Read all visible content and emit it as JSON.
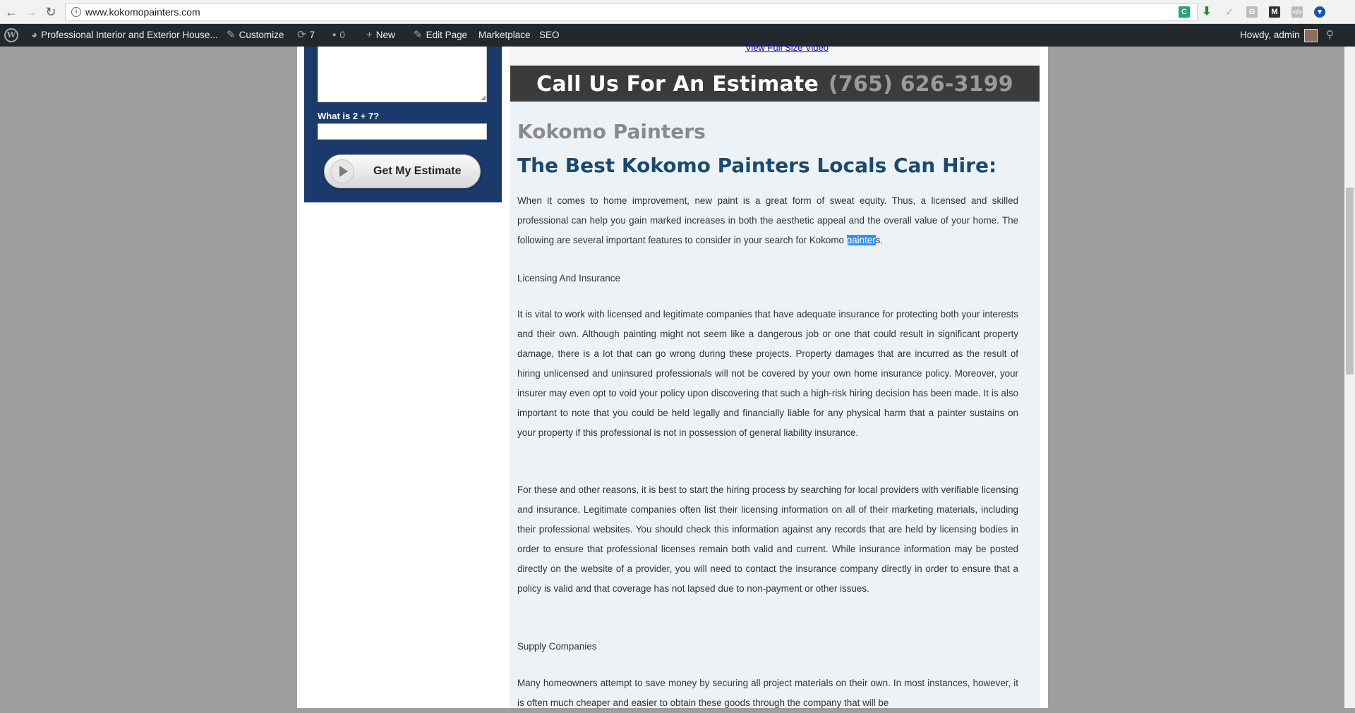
{
  "browser": {
    "url": "www.kokomopainters.com",
    "back_icon": "back-arrow-icon",
    "forward_icon": "forward-arrow-icon",
    "reload_icon": "reload-icon"
  },
  "adminbar": {
    "site_name": "Professional Interior and Exterior House...",
    "customize": "Customize",
    "updates_count": "7",
    "comments_count": "0",
    "new_label": "New",
    "edit_page": "Edit Page",
    "marketplace": "Marketplace",
    "seo": "SEO",
    "howdy": "Howdy, admin"
  },
  "sidebar": {
    "captcha_label": "What is 2 + 7?",
    "captcha_value": "",
    "submit_label": "Get My Estimate"
  },
  "main": {
    "video_link": "View Full Size Video",
    "call_text": "Call Us For An Estimate",
    "phone": "(765) 626-3199",
    "site_heading": "Kokomo Painters",
    "main_heading": "The Best Kokomo Painters Locals Can Hire:",
    "intro_before": "When it comes to home improvement, new paint is a great form of sweat equity. Thus, a licensed and skilled professional can help you gain marked increases in both the aesthetic appeal and the overall value of your home. The following are several important features to consider in your search for Kokomo ",
    "intro_highlight": "painter",
    "intro_after": "s.",
    "subheading_1": "Licensing And Insurance",
    "para_2": "It is vital to work with licensed and legitimate companies that have adequate insurance for protecting both your interests and their own. Although painting might not seem like a dangerous job or one that could result in significant property damage, there is a lot that can go wrong during these projects. Property damages that are incurred as the result of hiring unlicensed and uninsured professionals will not be covered by your own home insurance policy. Moreover, your insurer may even opt to void your policy upon discovering that such a high-risk hiring decision has been made. It is also important to note that you could be held legally and financially liable for any physical harm that a painter sustains on your property if this professional is not in possession of general liability insurance.",
    "para_3": "For these and other reasons, it is best to start the hiring process by searching for local providers with verifiable licensing and insurance. Legitimate companies often list their licensing information on all of their marketing materials, including their professional websites. You should check this information against any records that are held by licensing bodies in order to ensure that professional licenses remain both valid and current. While insurance information may be posted directly on the website of a provider, you will need to contact the insurance company directly in order to ensure that a policy is valid and that coverage has not lapsed due to non-payment or other issues.",
    "subheading_2": "Supply Companies",
    "para_4": "Many homeowners attempt to save money by securing all project materials on their own. In most instances, however, it is often much cheaper and easier to obtain these goods through the company that will be"
  }
}
